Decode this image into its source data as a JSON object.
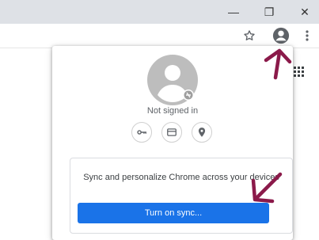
{
  "window": {
    "minimize_glyph": "—",
    "restore_glyph": "❐",
    "close_glyph": "✕"
  },
  "toolbar": {
    "bookmark_icon": "star-outline-icon",
    "profile_icon": "account-circle-icon",
    "menu_icon": "kebab-menu-icon"
  },
  "profile_popup": {
    "status": "Not signed in",
    "quick_actions": [
      {
        "name": "passwords",
        "icon": "key-icon"
      },
      {
        "name": "payment-methods",
        "icon": "credit-card-icon"
      },
      {
        "name": "addresses",
        "icon": "location-pin-icon"
      }
    ],
    "sync": {
      "description": "Sync and personalize Chrome across your devices",
      "button_label": "Turn on sync..."
    }
  },
  "colors": {
    "accent": "#1a73e8",
    "annotation_arrow": "#8b1a4a",
    "titlebar": "#dee1e6"
  }
}
